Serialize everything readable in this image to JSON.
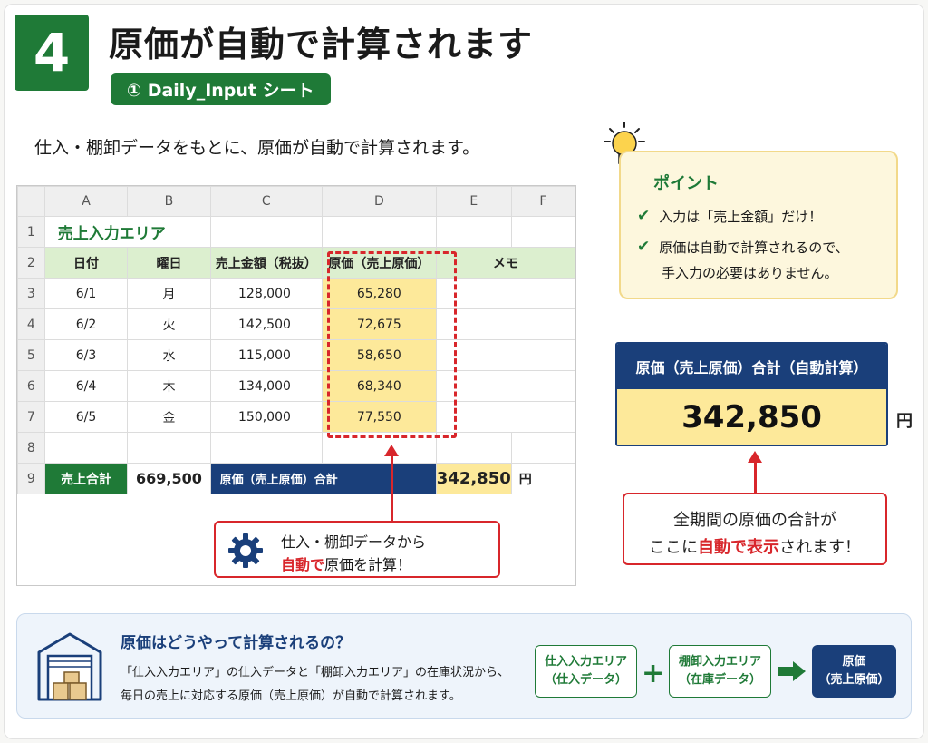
{
  "header": {
    "step_number": "4",
    "title": "原価が自動で計算されます",
    "sheet_badge": "① Daily_Input シート"
  },
  "intro": "仕入・棚卸データをもとに、原価が自動で計算されます。",
  "sheet": {
    "columns": [
      "A",
      "B",
      "C",
      "D",
      "E",
      "F"
    ],
    "row_numbers": [
      "1",
      "2",
      "3",
      "4",
      "5",
      "6",
      "7",
      "8",
      "9"
    ],
    "area_title": "売上入力エリア",
    "headers": [
      "日付",
      "曜日",
      "売上金額（税抜）",
      "原価（売上原価）",
      "メモ"
    ],
    "rows": [
      {
        "date": "6/1",
        "day": "月",
        "sales": "128,000",
        "cost": "65,280"
      },
      {
        "date": "6/2",
        "day": "火",
        "sales": "142,500",
        "cost": "72,675"
      },
      {
        "date": "6/3",
        "day": "水",
        "sales": "115,000",
        "cost": "58,650"
      },
      {
        "date": "6/4",
        "day": "木",
        "sales": "134,000",
        "cost": "68,340"
      },
      {
        "date": "6/5",
        "day": "金",
        "sales": "150,000",
        "cost": "77,550"
      }
    ],
    "sales_total_label": "売上合計",
    "sales_total_value": "669,500",
    "cost_total_label": "原価（売上原価）合計",
    "cost_total_value": "342,850",
    "yen": "円"
  },
  "callout_gear": {
    "line1": "仕入・棚卸データから",
    "line2_red": "自動で",
    "line2_rest": "原価を計算！"
  },
  "point": {
    "title": "ポイント",
    "item1": "入力は「売上金額」だけ！",
    "item2a": "原価は自動で計算されるので、",
    "item2b": "手入力の必要はありません。"
  },
  "total_card": {
    "label": "原価（売上原価）合計（自動計算）",
    "value": "342,850",
    "yen": "円"
  },
  "callout_total": {
    "line1": "全期間の原価の合計が",
    "line2_pre": "ここに",
    "line2_red": "自動で表示",
    "line2_post": "されます！"
  },
  "bottom": {
    "title": "原価はどうやって計算されるの？",
    "line1": "「仕入入力エリア」の仕入データと「棚卸入力エリア」の在庫状況から、",
    "line2": "毎日の売上に対応する原価（売上原価）が自動で計算されます。",
    "flow1_a": "仕入入力エリア",
    "flow1_b": "（仕入データ）",
    "plus": "+",
    "flow2_a": "棚卸入力エリア",
    "flow2_b": "（在庫データ）",
    "flow3_a": "原価",
    "flow3_b": "（売上原価）"
  },
  "colors": {
    "green": "#1f7a37",
    "navy": "#1a3f7a",
    "red": "#d8262b",
    "yellow": "#fde99a",
    "header_green": "#dcefcf"
  },
  "icons": [
    "lightbulb-icon",
    "checkmark-icon",
    "gear-icon",
    "warehouse-icon",
    "arrow-right-icon",
    "arrow-up-icon"
  ]
}
